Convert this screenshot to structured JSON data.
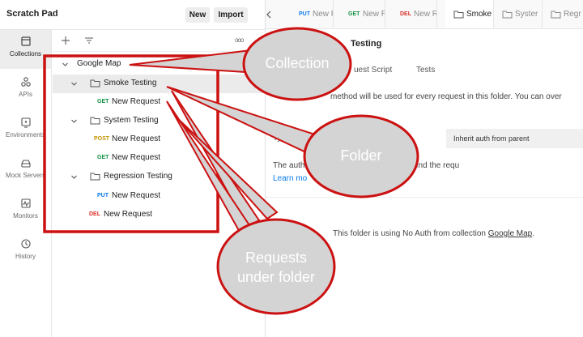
{
  "header": {
    "workspace_title": "Scratch Pad",
    "new_label": "New",
    "import_label": "Import"
  },
  "rail": [
    {
      "label": "Collections",
      "icon": "collections-icon"
    },
    {
      "label": "APIs",
      "icon": "apis-icon"
    },
    {
      "label": "Environments",
      "icon": "environments-icon"
    },
    {
      "label": "Mock Servers",
      "icon": "mock-servers-icon"
    },
    {
      "label": "Monitors",
      "icon": "monitors-icon"
    },
    {
      "label": "History",
      "icon": "history-icon"
    }
  ],
  "tree_toolbar": {
    "more": "ooo"
  },
  "tree": {
    "collection": "Google Map",
    "folder_smoke": "Smoke Testing",
    "smoke_req_method": "GET",
    "smoke_req_name": "New Request",
    "folder_system": "System Testing",
    "system_req1_method": "POST",
    "system_req1_name": "New Request",
    "system_req2_method": "GET",
    "system_req2_name": "New Request",
    "folder_regression": "Regression Testing",
    "regression_req_method": "PUT",
    "regression_req_name": "New Request",
    "root_req_method": "DEL",
    "root_req_name": "New Request"
  },
  "tabs": [
    {
      "method": "PUT",
      "title": "New R"
    },
    {
      "method": "GET",
      "title": "New R"
    },
    {
      "method": "DEL",
      "title": "New R"
    },
    {
      "method": "",
      "title": "Smoke"
    },
    {
      "method": "",
      "title": "Syster"
    },
    {
      "method": "",
      "title": "Regr"
    }
  ],
  "folder": {
    "title": "Testing",
    "subtabs": [
      "uest Script",
      "Tests"
    ],
    "auth_desc": "method will be used for every request in this folder. You can over",
    "auth_type_fragment": "Ty",
    "inherit_value": "Inherit auth from parent",
    "gen_note": "The auth                        atically generated when you send the requ",
    "learn_more": "Learn mo",
    "no_auth_prefix": "This folder is using No Auth from collection ",
    "no_auth_link": "Google Map",
    "no_auth_suffix": "."
  },
  "annotations": {
    "collection": "Collection",
    "folder": "Folder",
    "requests_line1": "Requests",
    "requests_line2": "under folder"
  },
  "colors": {
    "annotation_red": "#cc1111",
    "annotation_fill": "#d4d4d4",
    "get": "#0f8f43",
    "post": "#c79500",
    "put": "#097bed",
    "delete": "#d9302a"
  }
}
